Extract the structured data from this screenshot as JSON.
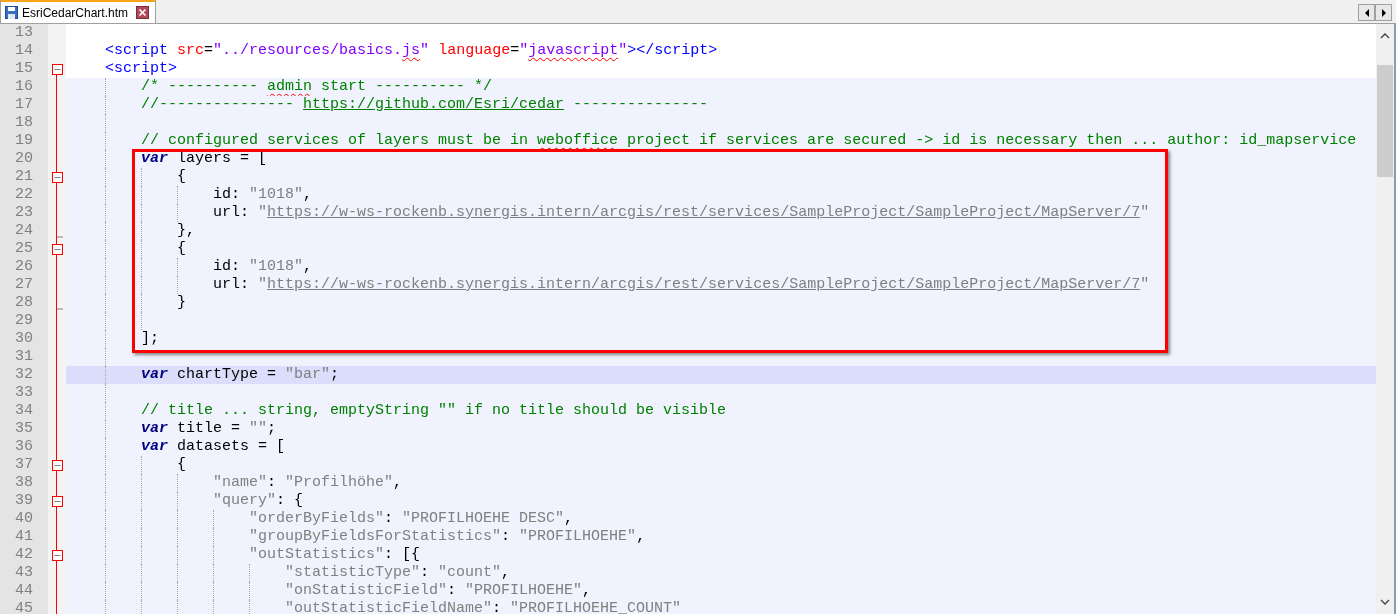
{
  "tabs": [
    {
      "label": "EsriCedarChart.htm",
      "selected": true
    }
  ],
  "editor": {
    "lines": [
      {
        "number": "13",
        "kind": "plain"
      },
      {
        "number": "14",
        "kind": "plain",
        "tokens": [
          {
            "kind": "tag",
            "text": "    <script "
          },
          {
            "kind": "attr",
            "text": "src"
          },
          {
            "kind": "plain",
            "text": "="
          },
          {
            "kind": "value",
            "text": "\"../resources/basics."
          },
          {
            "kind": "value",
            "text": "js",
            "misspelled": true
          },
          {
            "kind": "value",
            "text": "\" "
          },
          {
            "kind": "attr",
            "text": "language"
          },
          {
            "kind": "plain",
            "text": "="
          },
          {
            "kind": "value",
            "text": "\""
          },
          {
            "kind": "value",
            "text": "javascript",
            "misspelled": true
          },
          {
            "kind": "value",
            "text": "\""
          },
          {
            "kind": "tag",
            "text": "></script>"
          }
        ]
      },
      {
        "number": "15",
        "kind": "start",
        "tokens": [
          {
            "kind": "tag",
            "text": "    <script>"
          }
        ]
      },
      {
        "number": "16",
        "kind": "body",
        "in_block": true,
        "tokens": [
          {
            "kind": "comment",
            "text": "        /* ---------- "
          },
          {
            "kind": "comment",
            "text": "admin",
            "misspelled": true
          },
          {
            "kind": "comment",
            "text": " start ---------- */"
          }
        ]
      },
      {
        "number": "17",
        "kind": "body",
        "in_block": true,
        "tokens": [
          {
            "kind": "comment",
            "text": "        //--------------- "
          },
          {
            "kind": "comment_link",
            "text": "https://github.com/Esri/cedar"
          },
          {
            "kind": "comment",
            "text": " ---------------"
          }
        ]
      },
      {
        "number": "18",
        "kind": "body",
        "in_block": true
      },
      {
        "number": "19",
        "kind": "body",
        "in_block": true,
        "tokens": [
          {
            "kind": "comment",
            "text": "        // configured services of layers must be in "
          },
          {
            "kind": "comment",
            "text": "weboffice",
            "misspelled": true
          },
          {
            "kind": "comment",
            "text": " project if services are secured -> id is necessary then ... author: id_mapservice"
          }
        ]
      },
      {
        "number": "20",
        "kind": "body",
        "in_block": true,
        "boxed": true,
        "tokens": [
          {
            "kind": "keyword",
            "text": "        var"
          },
          {
            "kind": "plain",
            "text": " layers = ["
          }
        ]
      },
      {
        "number": "21",
        "kind": "start",
        "in_block": true,
        "boxed": true,
        "tokens": [
          {
            "kind": "plain",
            "text": "            {"
          }
        ]
      },
      {
        "number": "22",
        "kind": "body",
        "in_block": true,
        "boxed": true,
        "tokens": [
          {
            "kind": "plain",
            "text": "                id: "
          },
          {
            "kind": "string",
            "text": "\"1018\""
          },
          {
            "kind": "plain",
            "text": ","
          }
        ]
      },
      {
        "number": "23",
        "kind": "body",
        "in_block": true,
        "boxed": true,
        "tokens": [
          {
            "kind": "plain",
            "text": "                url: "
          },
          {
            "kind": "string",
            "text": "\""
          },
          {
            "kind": "link",
            "text": "https://w-ws-rockenb.synergis.intern/arcgis/rest/services/SampleProject/SampleProject/MapServer/7"
          },
          {
            "kind": "string",
            "text": "\""
          }
        ]
      },
      {
        "number": "24",
        "kind": "end",
        "in_block": true,
        "boxed": true,
        "tokens": [
          {
            "kind": "plain",
            "text": "            },"
          }
        ]
      },
      {
        "number": "25",
        "kind": "start",
        "in_block": true,
        "boxed": true,
        "tokens": [
          {
            "kind": "plain",
            "text": "            {"
          }
        ]
      },
      {
        "number": "26",
        "kind": "body",
        "in_block": true,
        "boxed": true,
        "tokens": [
          {
            "kind": "plain",
            "text": "                id: "
          },
          {
            "kind": "string",
            "text": "\"1018\""
          },
          {
            "kind": "plain",
            "text": ","
          }
        ]
      },
      {
        "number": "27",
        "kind": "body",
        "in_block": true,
        "boxed": true,
        "tokens": [
          {
            "kind": "plain",
            "text": "                url: "
          },
          {
            "kind": "string",
            "text": "\""
          },
          {
            "kind": "link",
            "text": "https://w-ws-rockenb.synergis.intern/arcgis/rest/services/SampleProject/SampleProject/MapServer/7"
          },
          {
            "kind": "string",
            "text": "\""
          }
        ]
      },
      {
        "number": "28",
        "kind": "end",
        "in_block": true,
        "boxed": true,
        "tokens": [
          {
            "kind": "plain",
            "text": "            }"
          }
        ]
      },
      {
        "number": "29",
        "kind": "body",
        "in_block": true,
        "boxed": true
      },
      {
        "number": "30",
        "kind": "body",
        "in_block": true,
        "boxed": true,
        "tokens": [
          {
            "kind": "plain",
            "text": "        ];"
          }
        ]
      },
      {
        "number": "31",
        "kind": "body",
        "in_block": true
      },
      {
        "number": "32",
        "kind": "body",
        "in_block": true,
        "current": true,
        "tokens": [
          {
            "kind": "keyword",
            "text": "        var"
          },
          {
            "kind": "plain",
            "text": " chartType = "
          },
          {
            "kind": "string",
            "text": "\"bar\""
          },
          {
            "kind": "plain",
            "text": ";"
          }
        ]
      },
      {
        "number": "33",
        "kind": "body",
        "in_block": true
      },
      {
        "number": "34",
        "kind": "body",
        "in_block": true,
        "tokens": [
          {
            "kind": "comment",
            "text": "        // title ... string, emptyString \"\" if no title should be visible"
          }
        ]
      },
      {
        "number": "35",
        "kind": "body",
        "in_block": true,
        "tokens": [
          {
            "kind": "keyword",
            "text": "        var"
          },
          {
            "kind": "plain",
            "text": " title = "
          },
          {
            "kind": "string",
            "text": "\"\""
          },
          {
            "kind": "plain",
            "text": ";"
          }
        ]
      },
      {
        "number": "36",
        "kind": "body",
        "in_block": true,
        "tokens": [
          {
            "kind": "keyword",
            "text": "        var"
          },
          {
            "kind": "plain",
            "text": " datasets = ["
          }
        ]
      },
      {
        "number": "37",
        "kind": "start",
        "in_block": true,
        "tokens": [
          {
            "kind": "plain",
            "text": "            {"
          }
        ]
      },
      {
        "number": "38",
        "kind": "body",
        "in_block": true,
        "tokens": [
          {
            "kind": "string",
            "text": "                \"name\""
          },
          {
            "kind": "plain",
            "text": ": "
          },
          {
            "kind": "string",
            "text": "\"Profilhöhe\""
          },
          {
            "kind": "plain",
            "text": ","
          }
        ]
      },
      {
        "number": "39",
        "kind": "start",
        "in_block": true,
        "tokens": [
          {
            "kind": "string",
            "text": "                \"query\""
          },
          {
            "kind": "plain",
            "text": ": {"
          }
        ]
      },
      {
        "number": "40",
        "kind": "body",
        "in_block": true,
        "tokens": [
          {
            "kind": "string",
            "text": "                    \"orderByFields\""
          },
          {
            "kind": "plain",
            "text": ": "
          },
          {
            "kind": "string",
            "text": "\"PROFILHOEHE DESC\""
          },
          {
            "kind": "plain",
            "text": ","
          }
        ]
      },
      {
        "number": "41",
        "kind": "body",
        "in_block": true,
        "tokens": [
          {
            "kind": "string",
            "text": "                    \"groupByFieldsForStatistics\""
          },
          {
            "kind": "plain",
            "text": ": "
          },
          {
            "kind": "string",
            "text": "\"PROFILHOEHE\""
          },
          {
            "kind": "plain",
            "text": ","
          }
        ]
      },
      {
        "number": "42",
        "kind": "start",
        "in_block": true,
        "tokens": [
          {
            "kind": "string",
            "text": "                    \"outStatistics\""
          },
          {
            "kind": "plain",
            "text": ": [{"
          }
        ]
      },
      {
        "number": "43",
        "kind": "body",
        "in_block": true,
        "tokens": [
          {
            "kind": "string",
            "text": "                        \"statisticType\""
          },
          {
            "kind": "plain",
            "text": ": "
          },
          {
            "kind": "string",
            "text": "\"count\""
          },
          {
            "kind": "plain",
            "text": ","
          }
        ]
      },
      {
        "number": "44",
        "kind": "body",
        "in_block": true,
        "tokens": [
          {
            "kind": "string",
            "text": "                        \"onStatisticField\""
          },
          {
            "kind": "plain",
            "text": ": "
          },
          {
            "kind": "string",
            "text": "\"PROFILHOEHE\""
          },
          {
            "kind": "plain",
            "text": ","
          }
        ]
      },
      {
        "number": "45",
        "kind": "body",
        "in_block": true,
        "tokens": [
          {
            "kind": "string",
            "text": "                        \"outStatisticFieldName\""
          },
          {
            "kind": "plain",
            "text": ": "
          },
          {
            "kind": "string",
            "text": "\"PROFILHOEHE_COUNT\""
          }
        ]
      }
    ]
  }
}
